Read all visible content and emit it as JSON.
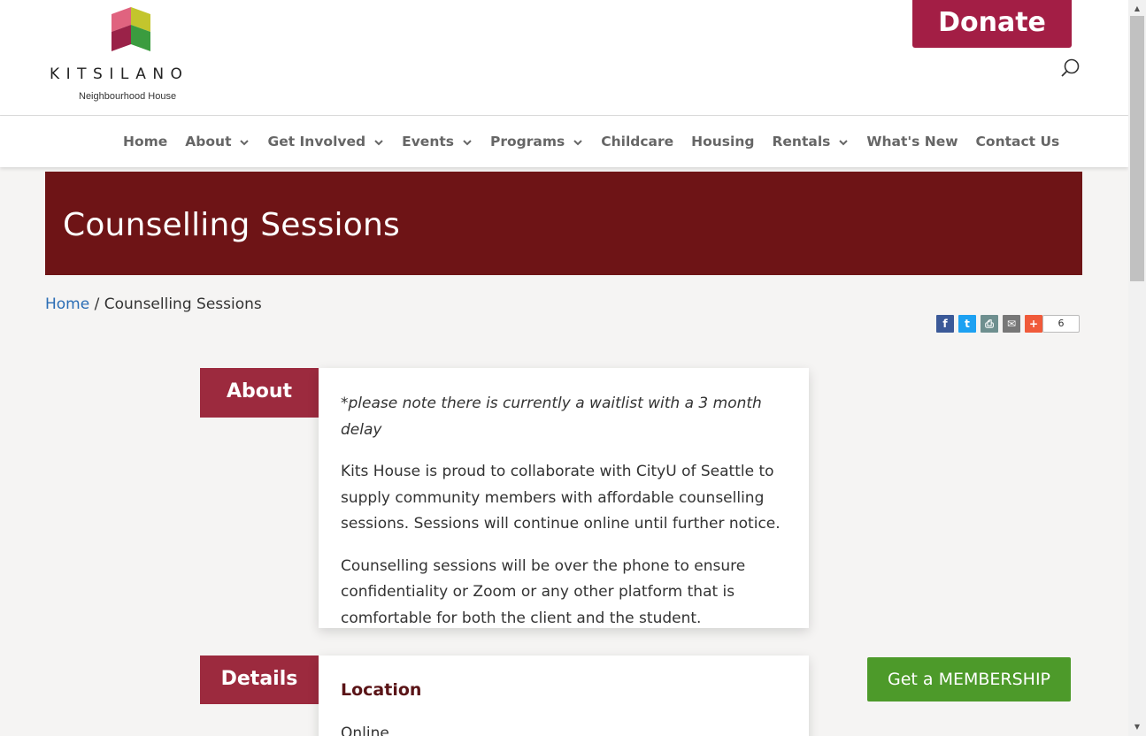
{
  "header": {
    "logo_word": "KITSILANO",
    "logo_sub": "Neighbourhood House",
    "donate_label": "Donate"
  },
  "nav": {
    "items": [
      {
        "label": "Home",
        "has_dropdown": false
      },
      {
        "label": "About",
        "has_dropdown": true
      },
      {
        "label": "Get Involved",
        "has_dropdown": true
      },
      {
        "label": "Events",
        "has_dropdown": true
      },
      {
        "label": "Programs",
        "has_dropdown": true
      },
      {
        "label": "Childcare",
        "has_dropdown": false
      },
      {
        "label": "Housing",
        "has_dropdown": false
      },
      {
        "label": "Rentals",
        "has_dropdown": true
      },
      {
        "label": "What's New",
        "has_dropdown": false
      },
      {
        "label": "Contact Us",
        "has_dropdown": false
      }
    ]
  },
  "page": {
    "title": "Counselling Sessions"
  },
  "breadcrumb": {
    "home": "Home",
    "separator": " / ",
    "current": "Counselling Sessions"
  },
  "share": {
    "count": "6",
    "buttons": [
      {
        "icon": "facebook-icon",
        "color": "#3b5998",
        "glyph": "f"
      },
      {
        "icon": "twitter-icon",
        "color": "#1da1f2",
        "glyph": "t"
      },
      {
        "icon": "print-icon",
        "color": "#6e8f8f",
        "glyph": "⎙"
      },
      {
        "icon": "email-icon",
        "color": "#777777",
        "glyph": "✉"
      },
      {
        "icon": "plus-icon",
        "color": "#f05a3a",
        "glyph": "+"
      }
    ]
  },
  "about": {
    "label": "About",
    "note": "*please note there is currently a waitlist with a 3 month delay",
    "p1": "Kits House is proud to collaborate with  CityU of Seattle to supply community members with affordable counselling sessions. Sessions will continue online until further notice.",
    "p2": "Counselling sessions will be over the phone to ensure confidentiality or Zoom or any other platform that is comfortable for both the client and the student."
  },
  "details": {
    "label": "Details",
    "location_heading": "Location",
    "location_value": "Online"
  },
  "membership_button": "Get a MEMBERSHIP",
  "colors": {
    "donate": "#a31e45",
    "title_band": "#6e1416",
    "tab": "#9c2a3e",
    "membership": "#4d9a2a",
    "link": "#2a6db5"
  }
}
